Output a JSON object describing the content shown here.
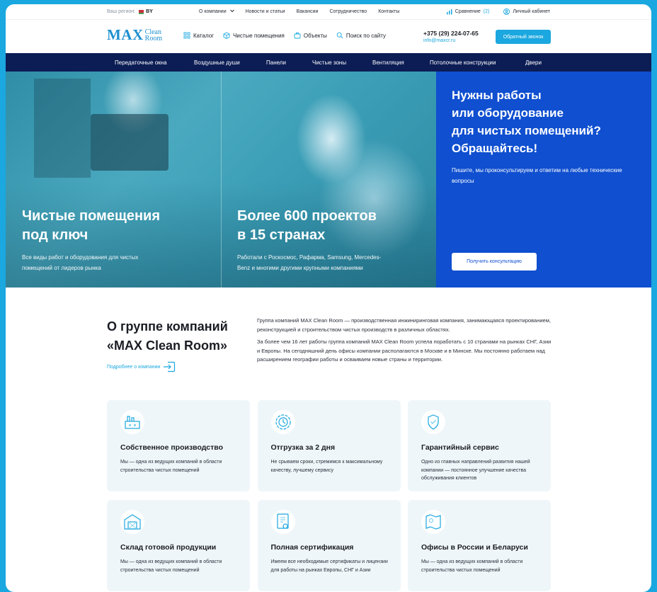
{
  "topbar": {
    "region_label": "Ваш регион:",
    "region_value": "BY",
    "nav": [
      "О компании",
      "Новости и статьи",
      "Вакансии",
      "Сотрудничество",
      "Контакты"
    ],
    "compare_label": "Сравнение",
    "compare_count": "(2)",
    "account_label": "Личный кабинет"
  },
  "header": {
    "logo_max": "MAX",
    "logo_clean": "Clean",
    "logo_room": "Room",
    "nav": {
      "catalog": "Каталог",
      "cleanrooms": "Чистые помещения",
      "objects": "Объекты",
      "search": "Поиск по сайту"
    },
    "phone": "+375 (29) 224-07-65",
    "email": "info@maxcr.ru",
    "callback_label": "Обратный звонок"
  },
  "mainnav": [
    "Передаточные окна",
    "Воздушные души",
    "Панели",
    "Чистые зоны",
    "Вентиляция",
    "Потолочные конструкции",
    "Двери"
  ],
  "hero": {
    "col1": {
      "title_l1": "Чистые помещения",
      "title_l2": "под ключ",
      "sub_l1": "Все виды работ и оборудования для чистых",
      "sub_l2": "помещений от лидеров рынка"
    },
    "col2": {
      "title_l1": "Более 600 проектов",
      "title_l2": "в 15 странах",
      "sub_l1": "Работали с Роскосмос, Рафарма, Samsung, Mercedes-",
      "sub_l2": "Benz и многими другими крупными компаниями"
    },
    "cta": {
      "title_l1": "Нужны работы",
      "title_l2": "или оборудование",
      "title_l3": "для чистых помещений?",
      "title_l4": "Обращайтесь!",
      "text": "Пишите, мы проконсультируем и ответим на любые технические вопросы",
      "button": "Получить консультацию"
    }
  },
  "about": {
    "title_l1": "О группе компаний",
    "title_l2": "«MAX Clean Room»",
    "more_link": "Подробнее о компании",
    "p1": "Группа компаний MAX Clean Room — производственная инжиниринговая компания, занимающаяся проектированием, реконструкцией и строительством чистых производств в различных областях.",
    "p2": "За более чем 16 лет работы группа компаний MAX Clean Room успела поработать с 10 странами на рынках СНГ, Азии и Европы. На сегодняшний день офисы компании располагаются в Москве и в Минске. Мы постоянно работаем над расширением географии работы и осваиваем новые страны и территории."
  },
  "features": [
    {
      "icon": "factory-icon",
      "title": "Собственное производство",
      "text": "Мы — одна из ведущих компаний в области строительства чистых помещений"
    },
    {
      "icon": "clock-icon",
      "title": "Отгрузка за 2 дня",
      "text": "Не срываем сроки, стремимся к максимальному качеству, лучшему сервису"
    },
    {
      "icon": "guarantee-icon",
      "title": "Гарантийный сервис",
      "text": "Одно из главных направлений развития нашей компании — постоянное улучшение качества обслуживания клиентов"
    },
    {
      "icon": "warehouse-icon",
      "title": "Склад готовой продукции",
      "text": "Мы — одна из ведущих компаний в области строительства чистых помещений"
    },
    {
      "icon": "certificate-icon",
      "title": "Полная сертификация",
      "text": "Имеем все необходимые сертификаты и лицензии для работы на рынках Европы, СНГ и Азии"
    },
    {
      "icon": "map-icon",
      "title": "Офисы в России и Беларуси",
      "text": "Мы — одна из ведущих компаний в области строительства чистых помещений"
    }
  ],
  "colors": {
    "accent": "#1ba7df",
    "navy": "#0c1d55",
    "cta_blue": "#0f4fd0",
    "card_bg": "#eff6f9"
  }
}
